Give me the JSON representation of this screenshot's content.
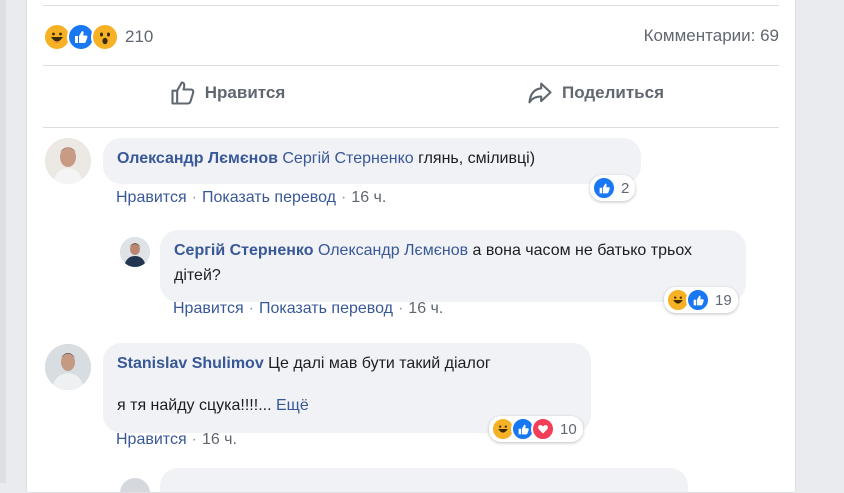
{
  "post": {
    "reaction_types": [
      "haha",
      "like",
      "wow"
    ],
    "reaction_count": "210",
    "comments_label": "Комментарии: 69"
  },
  "actions": {
    "like_label": "Нравится",
    "share_label": "Поделиться"
  },
  "comments": [
    {
      "author": "Олександр Лємєнов",
      "mention": "Сергій Стерненко",
      "text": " глянь, сміливці)",
      "like_label": "Нравится",
      "translate_label": "Показать перевод",
      "time": "16 ч.",
      "reaction_types": [
        "like"
      ],
      "reaction_count": "2"
    },
    {
      "author": "Сергій Стерненко",
      "mention": "Олександр Лємєнов",
      "text": " а вона часом не батько трьох дітей?",
      "like_label": "Нравится",
      "translate_label": "Показать перевод",
      "time": "16 ч.",
      "reaction_types": [
        "haha",
        "like"
      ],
      "reaction_count": "19"
    },
    {
      "author": "Stanislav Shulimov",
      "text_line1": " Це далі мав бути такий діалог",
      "text_line2": "я тя найду сцука!!!!...",
      "more_label": "Ещё",
      "like_label": "Нравится",
      "time": "16 ч.",
      "reaction_types": [
        "haha",
        "like",
        "love"
      ],
      "reaction_count": "10"
    }
  ],
  "colors": {
    "link": "#385898",
    "meta": "#606770",
    "bubble": "#f0f2f5",
    "like": "#1877f2",
    "haha": "#f7b125",
    "love": "#f33e58"
  }
}
